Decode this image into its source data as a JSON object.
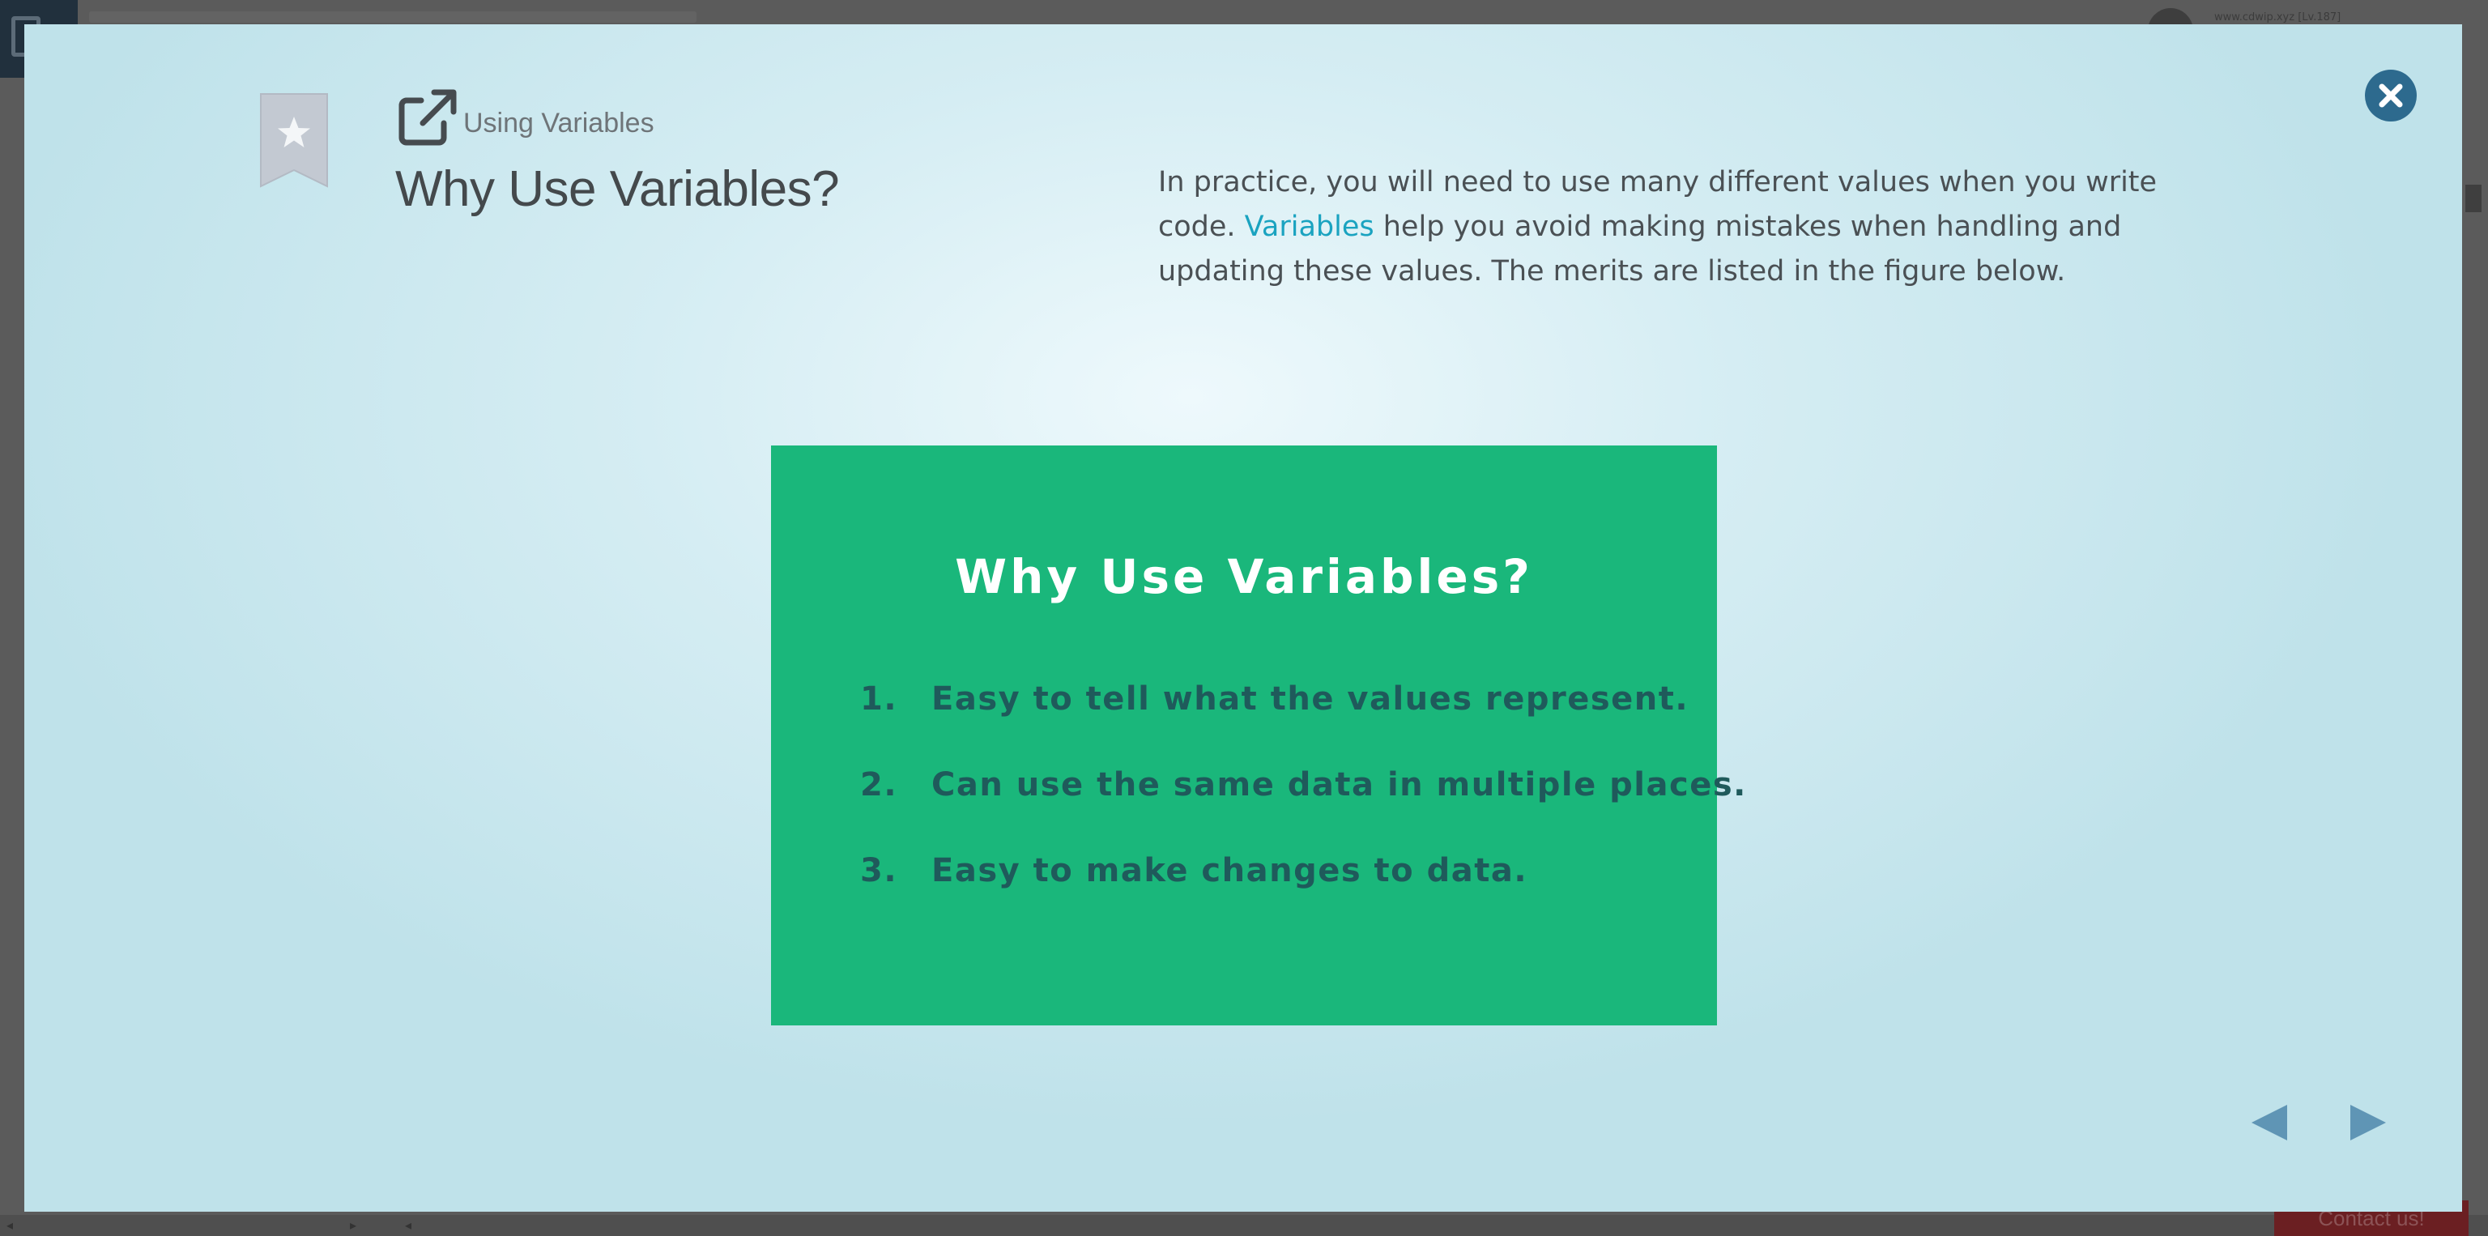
{
  "background": {
    "url_text": "www.cdwip.xyz [Lv.187]",
    "contact_label": "Contact us!"
  },
  "modal": {
    "breadcrumb": "Using Variables",
    "title": "Why Use Variables?",
    "description": {
      "before_link": "In practice, you will need to use many different values when you write code. ",
      "link_text": "Variables",
      "after_link": " help you avoid making mistakes when handling and updating these values. The merits are listed in the figure below."
    },
    "figure": {
      "title": "Why Use Variables?",
      "items": [
        {
          "num": "1.",
          "text": "Easy to tell what the values represent."
        },
        {
          "num": "2.",
          "text": "Can use the same data in multiple places."
        },
        {
          "num": "3.",
          "text": "Easy to make changes to data."
        }
      ]
    }
  },
  "colors": {
    "accent_link": "#1aa3c0",
    "figure_bg": "#1ab77b",
    "close_button": "#2d6a8e",
    "nav_arrow": "#5f95b5"
  },
  "icons": {
    "bookmark": "bookmark-star-icon",
    "external_link": "external-link-icon",
    "close": "close-icon",
    "previous": "arrow-left-icon",
    "next": "arrow-right-icon"
  }
}
